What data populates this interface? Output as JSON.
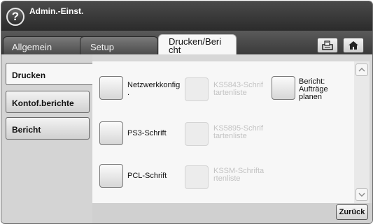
{
  "header": {
    "help_icon": "?",
    "title": "Admin.-Einst."
  },
  "tabs": [
    {
      "label": "Allgemein"
    },
    {
      "label": "Setup"
    },
    {
      "label": "Drucken/Bericht",
      "line1": "Drucken/Beri",
      "line2": "cht",
      "active": true
    }
  ],
  "header_buttons": {
    "fax_icon": "fax-icon",
    "home_icon": "home-icon"
  },
  "sidebar": {
    "items": [
      {
        "label": "Drucken",
        "selected": true
      },
      {
        "label": "Kontof.berichte"
      },
      {
        "label": "Bericht"
      }
    ]
  },
  "options": {
    "col1": [
      {
        "line1": "Netzwerkkonfig",
        "line2": "."
      },
      {
        "line1": "PS3-Schrift"
      },
      {
        "line1": "PCL-Schrift"
      }
    ],
    "col2": [
      {
        "line1": "KS5843-Schrif",
        "line2": "tartenliste",
        "disabled": true
      },
      {
        "line1": "KS5895-Schrif",
        "line2": "tartenliste",
        "disabled": true
      },
      {
        "line1": "KSSM-Schrifta",
        "line2": "rtenliste",
        "disabled": true
      }
    ],
    "col3": [
      {
        "line1": "Bericht:",
        "line2": "Aufträge",
        "line3": "planen"
      }
    ]
  },
  "scrollbar": {
    "up_icon": "chevron-up-icon",
    "down_icon": "chevron-down-icon"
  },
  "footer": {
    "back_label": "Zurück"
  },
  "colors": {
    "header_bg": "#2b2b2b",
    "panel_bg": "#f7f7f7",
    "disabled_text": "#c3c3c3"
  }
}
